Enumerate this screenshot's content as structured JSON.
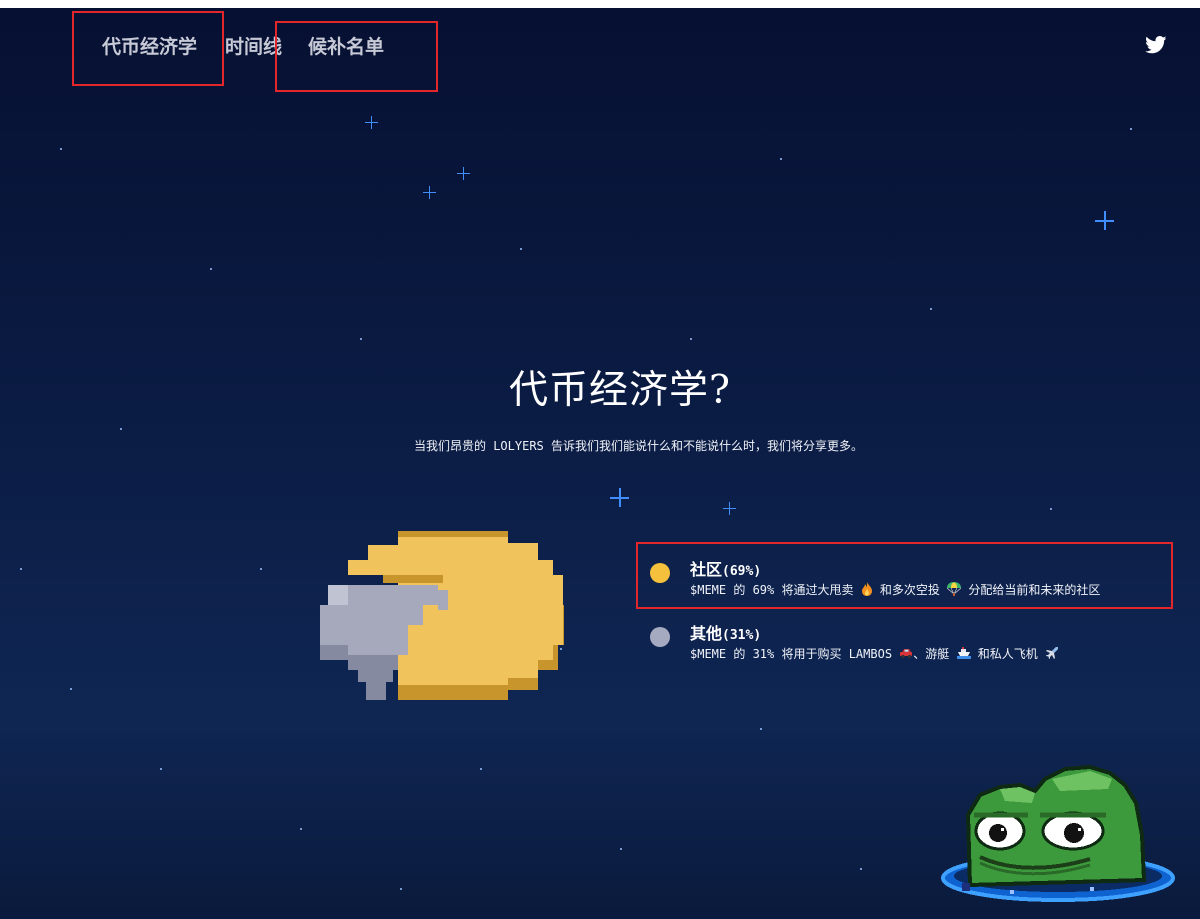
{
  "nav": {
    "items": [
      {
        "label": "代币经济学"
      },
      {
        "label": "时间线"
      },
      {
        "label": "候补名单"
      }
    ],
    "twitter_icon": "twitter-icon"
  },
  "hero": {
    "title": "代币经济学?",
    "subtitle": "当我们昂贵的 LOLYERS 告诉我们我们能说什么和不能说什么时，我们将分享更多。"
  },
  "chart_data": {
    "type": "pie",
    "categories": [
      "社区",
      "其他"
    ],
    "values": [
      69,
      31
    ],
    "colors": [
      "#f0c35c",
      "#a6a9bb"
    ]
  },
  "legend": [
    {
      "name": "社区",
      "pct": "(69%)",
      "color": "#f5c03c",
      "parts": [
        "$MEME 的 69% 将通过大甩卖 ",
        " 和多次空投 ",
        " 分配给当前和未来的社区"
      ],
      "icons": [
        "fire-icon",
        "parachute-icon"
      ]
    },
    {
      "name": "其他",
      "pct": "(31%)",
      "color": "#a6aac0",
      "parts": [
        "$MEME 的 31% 将用于购买 LAMBOS ",
        "、游艇 ",
        " 和私人飞机 "
      ],
      "icons": [
        "car-icon",
        "ship-icon",
        "airplane-icon"
      ]
    }
  ],
  "colors": {
    "background_top": "#061032",
    "background_bottom": "#0f2653",
    "highlight": "#e3262a"
  }
}
